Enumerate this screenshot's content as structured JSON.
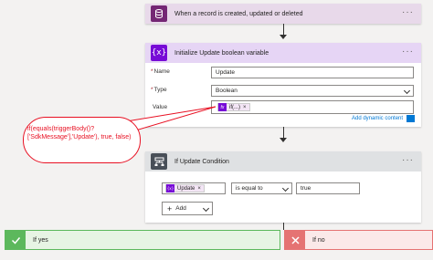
{
  "trigger": {
    "title": "When a record is created, updated or deleted",
    "icon": "database-icon",
    "color": "#742774"
  },
  "init_var": {
    "title": "Initialize Update boolean variable",
    "icon": "variable-icon",
    "color": "#770bd6",
    "name_label": "Name",
    "name_value": "Update",
    "type_label": "Type",
    "type_value": "Boolean",
    "value_label": "Value",
    "value_token": "if(...)",
    "value_token_icon": "fx",
    "add_dynamic": "Add dynamic content"
  },
  "callout": {
    "text": "if(equals(triggerBody()?['SdkMessage'],'Update'), true, false)",
    "color": "#e81123"
  },
  "condition": {
    "title": "If Update Condition",
    "icon": "condition-icon",
    "color": "#484f58",
    "left_token": "Update",
    "operator": "is equal to",
    "right_value": "true",
    "add_label": "Add"
  },
  "branches": {
    "yes": {
      "title": "If yes",
      "color": "#5cb85c",
      "icon": "check-icon"
    },
    "no": {
      "title": "If no",
      "color": "#e57373",
      "icon": "close-icon"
    }
  },
  "menu_glyph": "···"
}
